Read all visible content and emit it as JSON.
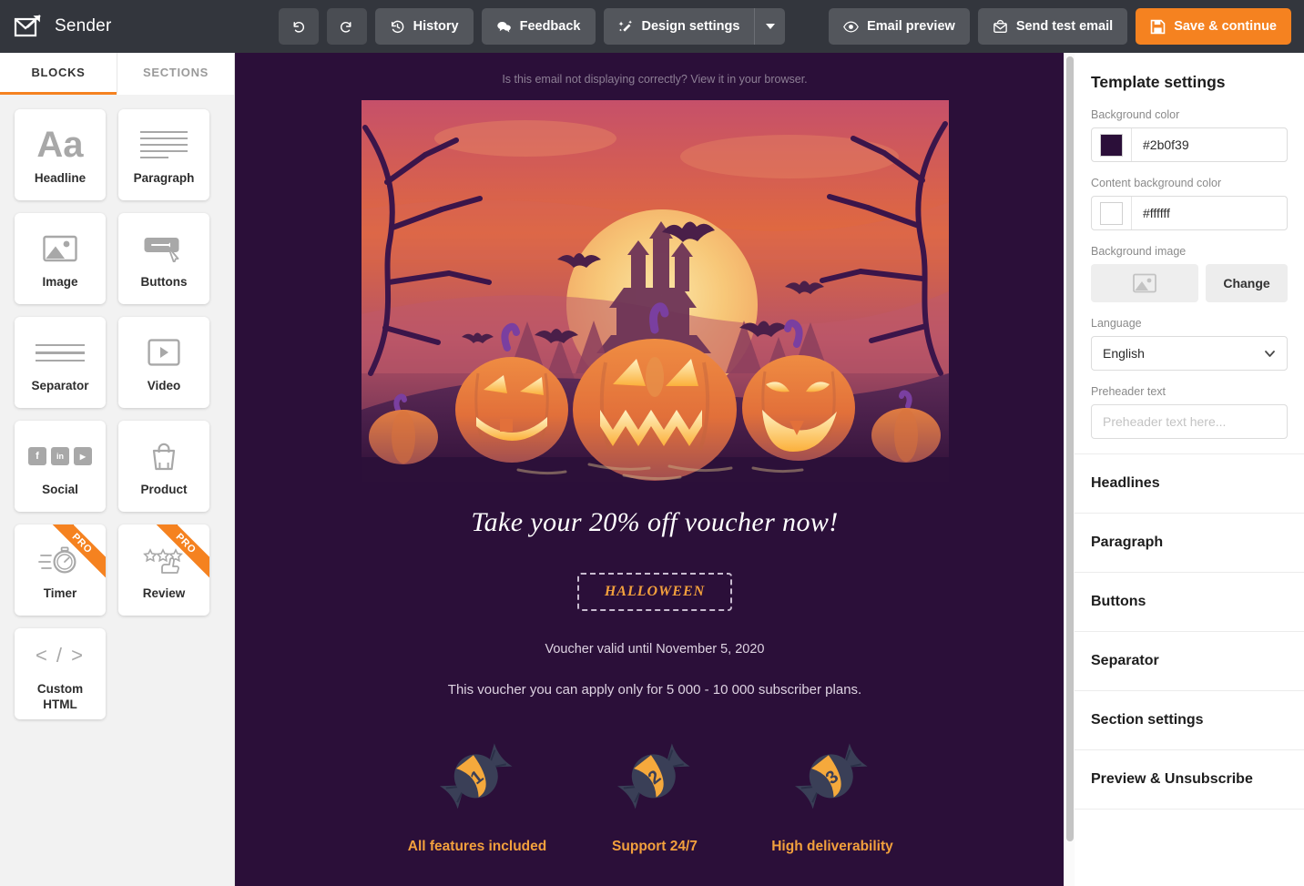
{
  "app": {
    "brand_name": "Sender",
    "brand_logo_icon": "envelope-arrow-icon"
  },
  "toolbar": {
    "undo_icon": "undo-icon",
    "redo_icon": "redo-icon",
    "history_label": "History",
    "history_icon": "history-clock-icon",
    "feedback_label": "Feedback",
    "feedback_icon": "chat-bubbles-icon",
    "design_settings_label": "Design settings",
    "design_settings_icon": "magic-wand-icon",
    "design_settings_caret_icon": "chevron-down-icon",
    "email_preview_label": "Email preview",
    "email_preview_icon": "eye-icon",
    "send_test_label": "Send test email",
    "send_test_icon": "envelope-icon",
    "save_continue_label": "Save & continue",
    "save_continue_icon": "floppy-disk-icon",
    "primary_color": "#f58220"
  },
  "sidebar": {
    "tabs": [
      {
        "label": "BLOCKS",
        "active": true
      },
      {
        "label": "SECTIONS",
        "active": false
      }
    ],
    "blocks": [
      {
        "label": "Headline",
        "icon": "text-aa-icon",
        "pro": false
      },
      {
        "label": "Paragraph",
        "icon": "text-lines-icon",
        "pro": false
      },
      {
        "label": "Image",
        "icon": "image-icon",
        "pro": false
      },
      {
        "label": "Buttons",
        "icon": "button-cursor-icon",
        "pro": false
      },
      {
        "label": "Separator",
        "icon": "separator-icon",
        "pro": false
      },
      {
        "label": "Video",
        "icon": "video-play-icon",
        "pro": false
      },
      {
        "label": "Social",
        "icon": "social-icons",
        "pro": false
      },
      {
        "label": "Product",
        "icon": "shopping-bag-icon",
        "pro": false
      },
      {
        "label": "Timer",
        "icon": "stopwatch-icon",
        "pro": true,
        "pro_badge": "PRO"
      },
      {
        "label": "Review",
        "icon": "stars-hand-icon",
        "pro": true,
        "pro_badge": "PRO"
      },
      {
        "label": "Custom HTML",
        "icon": "code-icon",
        "pro": false
      }
    ]
  },
  "email": {
    "browser_note": "Is this email not displaying correctly? View it in your browser.",
    "hero_alt": "halloween-pumpkins-hero-image",
    "headline": "Take your 20% off voucher now!",
    "voucher_code": "HALLOWEEN",
    "valid_text": "Voucher valid until November 5, 2020",
    "apply_text": "This voucher you can apply only for 5 000 - 10 000 subscriber plans.",
    "features": [
      {
        "number": "1",
        "label": "All features included",
        "icon": "candy-icon"
      },
      {
        "number": "2",
        "label": "Support 24/7",
        "icon": "candy-icon"
      },
      {
        "number": "3",
        "label": "High deliverability",
        "icon": "candy-icon"
      }
    ],
    "colors": {
      "background": "#2b0f39",
      "accent": "#f2a03d",
      "text": "#ded3e2"
    }
  },
  "settings": {
    "title": "Template settings",
    "background_color": {
      "label": "Background color",
      "value": "#2b0f39"
    },
    "content_background_color": {
      "label": "Content background color",
      "value": "#ffffff"
    },
    "background_image": {
      "label": "Background image",
      "change_label": "Change",
      "thumb_icon": "image-placeholder-icon"
    },
    "language": {
      "label": "Language",
      "value": "English",
      "caret_icon": "chevron-down-icon"
    },
    "preheader": {
      "label": "Preheader text",
      "value": "",
      "placeholder": "Preheader text here..."
    },
    "accordion": [
      {
        "label": "Headlines"
      },
      {
        "label": "Paragraph"
      },
      {
        "label": "Buttons"
      },
      {
        "label": "Separator"
      },
      {
        "label": "Section settings"
      },
      {
        "label": "Preview & Unsubscribe"
      }
    ]
  }
}
